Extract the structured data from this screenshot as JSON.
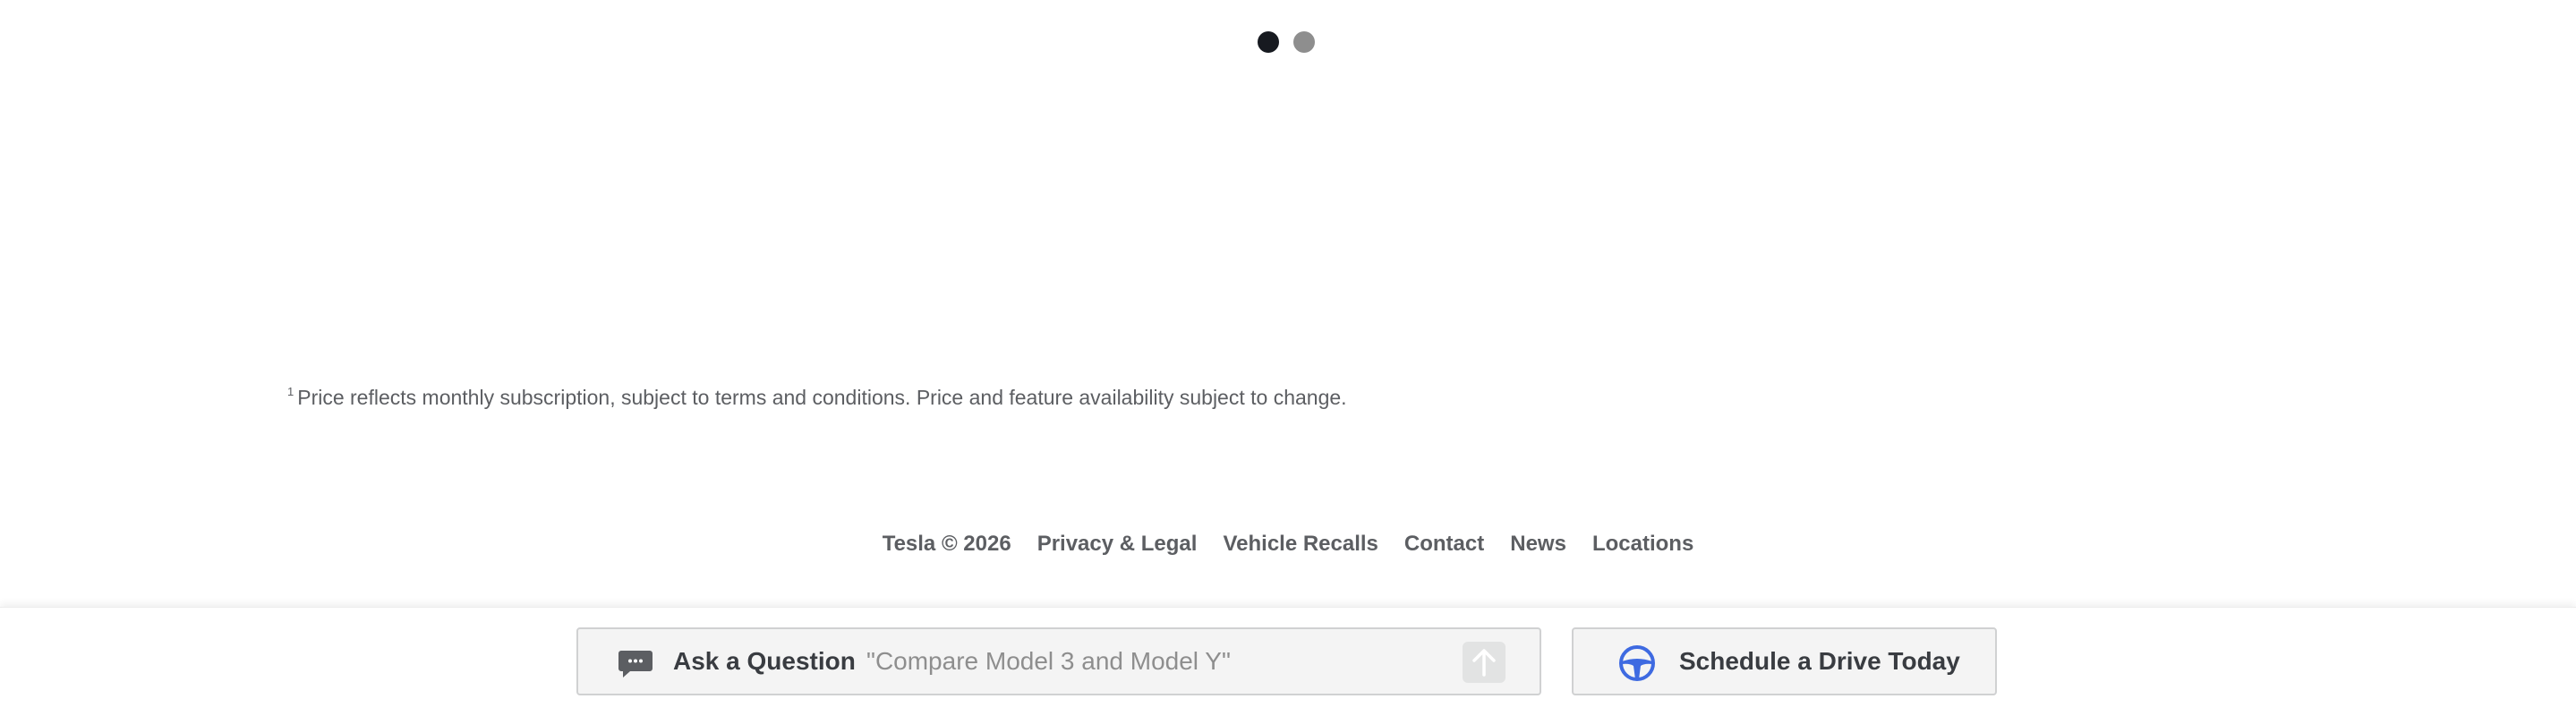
{
  "carousel": {
    "dots": [
      "active",
      "inactive"
    ]
  },
  "footnote": {
    "marker": "1",
    "text": "Price reflects monthly subscription, subject to terms and conditions. Price and feature availability subject to change."
  },
  "footer": {
    "copyright": "Tesla © 2026",
    "links": {
      "privacy": "Privacy & Legal",
      "recalls": "Vehicle Recalls",
      "contact": "Contact",
      "news": "News",
      "locations": "Locations"
    }
  },
  "bottom_bar": {
    "ask": {
      "icon": "chat-bubble-icon",
      "label": "Ask a Question",
      "placeholder": "\"Compare Model 3 and Model Y\"",
      "send_icon": "arrow-up-icon"
    },
    "drive": {
      "icon": "steering-wheel-icon",
      "label": "Schedule a Drive Today"
    }
  },
  "colors": {
    "text": "#393c41",
    "muted": "#5c5e62",
    "dot_active": "#171a20",
    "dot_inactive": "#8e8e8e",
    "accent_blue": "#3e6ae1",
    "field_bg": "#f4f4f4"
  }
}
